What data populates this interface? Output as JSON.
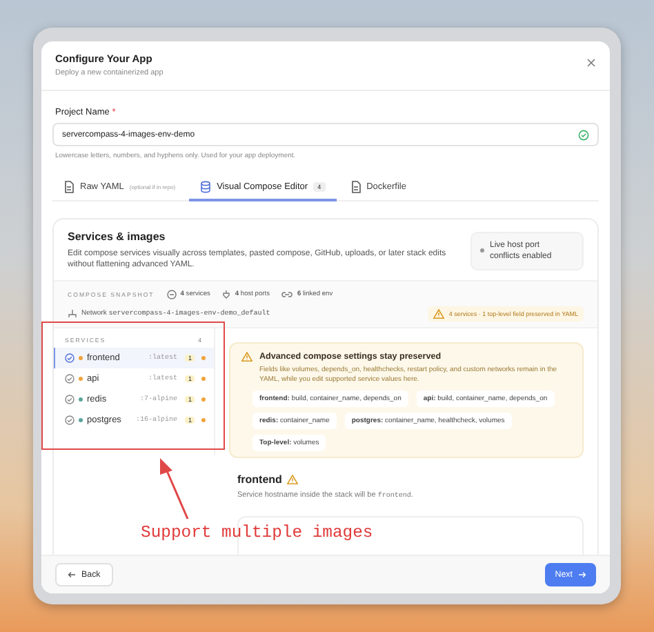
{
  "dialog": {
    "title": "Configure Your App",
    "subtitle": "Deploy a new containerized app"
  },
  "project_name": {
    "label": "Project Name",
    "required_mark": "*",
    "value": "servercompass-4-images-env-demo",
    "valid": true,
    "hint": "Lowercase letters, numbers, and hyphens only. Used for your app deployment."
  },
  "tabs": [
    {
      "label": "Raw YAML",
      "note": "(optional if in repo)",
      "selected": false
    },
    {
      "label": "Visual Compose Editor",
      "badge": "4",
      "selected": true
    },
    {
      "label": "Dockerfile",
      "selected": false
    }
  ],
  "services_card": {
    "title": "Services & images",
    "description": "Edit compose services visually across templates, pasted compose, GitHub, uploads, or later stack edits without flattening advanced YAML.",
    "live_badge": "Live host port conflicts enabled",
    "snapshot": {
      "label": "COMPOSE SNAPSHOT",
      "stats": [
        {
          "count": "4",
          "label": "services"
        },
        {
          "count": "4",
          "label": "host ports"
        },
        {
          "count": "6",
          "label": "linked env"
        }
      ],
      "network_label": "Network",
      "network": "servercompass-4-images-env-demo_default",
      "warning": "4 services · 1 top-level field preserved in YAML"
    }
  },
  "services": {
    "heading": "SERVICES",
    "count": "4",
    "items": [
      {
        "name": "frontend",
        "tag": ":latest",
        "count": "1",
        "color": "#f0a33a",
        "selected": true
      },
      {
        "name": "api",
        "tag": ":latest",
        "count": "1",
        "color": "#f0a33a",
        "selected": false
      },
      {
        "name": "redis",
        "tag": ":7-alpine",
        "count": "1",
        "color": "#5aa59a",
        "selected": false
      },
      {
        "name": "postgres",
        "tag": ":16-alpine",
        "count": "1",
        "color": "#5aa59a",
        "selected": false
      }
    ]
  },
  "advisory": {
    "title": "Advanced compose settings stay preserved",
    "body": "Fields like volumes, depends_on, healthchecks, restart policy, and custom networks remain in the YAML, while you edit supported service values here.",
    "chips": [
      "**frontend:** build, container_name, depends_on",
      "**api:** build, container_name, depends_on",
      "**redis:** container_name",
      "**postgres:** container_name, healthcheck, volumes",
      "**Top-level:** volumes"
    ]
  },
  "detail": {
    "title": "frontend",
    "note": "Service hostname inside the stack will be",
    "code": "frontend",
    "note_end": "."
  },
  "footer": {
    "back": "Back",
    "next": "Next"
  },
  "annotation": {
    "text": "Support multiple images"
  }
}
